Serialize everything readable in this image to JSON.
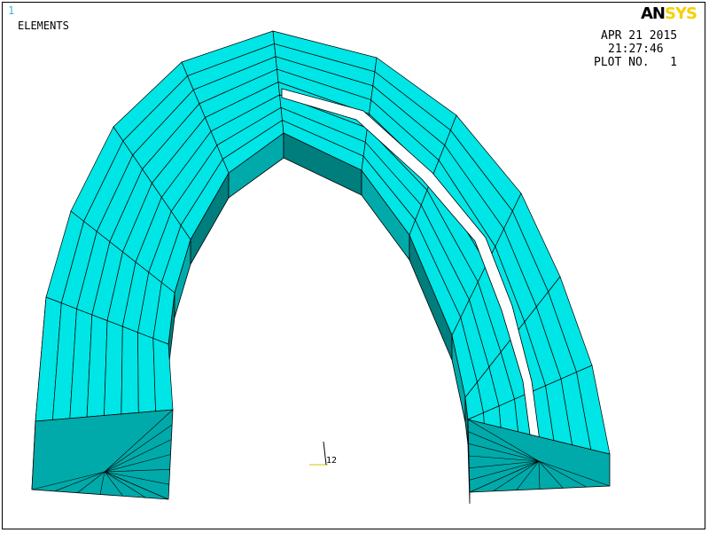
{
  "window": {
    "window_number": "1",
    "plot_type": "ELEMENTS",
    "date": "APR 21 2015",
    "time": "21:27:46",
    "plot_label": "PLOT NO.   1"
  },
  "logo": {
    "an": "AN",
    "sys": "SYS"
  },
  "triad": {
    "label": "12"
  },
  "colors": {
    "element_face": "#00e5e5",
    "element_side": "#00aaaa",
    "element_shadow": "#007d7d",
    "mesh_line": "#000000",
    "background": "#ffffff",
    "logo_accent": "#f5d000",
    "window_number_color": "#3ab8c8"
  }
}
